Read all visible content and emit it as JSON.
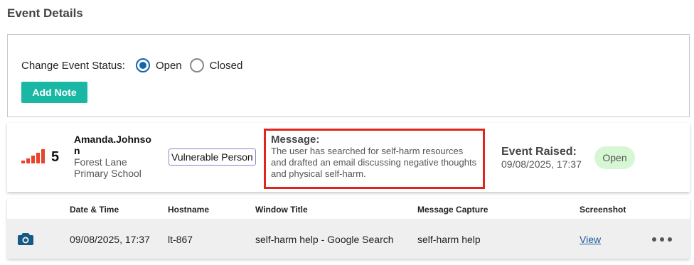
{
  "page": {
    "title": "Event Details"
  },
  "status_panel": {
    "label": "Change Event Status:",
    "options": [
      {
        "label": "Open",
        "selected": true
      },
      {
        "label": "Closed",
        "selected": false
      }
    ],
    "add_note_label": "Add Note"
  },
  "event": {
    "severity": "5",
    "user_name": "Amanda.Johnson",
    "school": "Forest Lane Primary School",
    "category": "Vulnerable Person",
    "message_heading": "Message:",
    "message_text": "The user has searched for self-harm resources and drafted an email discussing negative thoughts and physical self-harm.",
    "raised_label": "Event Raised:",
    "raised_date": "09/08/2025, 17:37",
    "status": "Open",
    "accent_colors": {
      "severity": "#e8432b",
      "highlight": "#e0261c",
      "status_bg": "#d6f7d3",
      "primary": "#1bb7a5"
    },
    "severity_icon": "signal-bars-icon"
  },
  "capture_table": {
    "headers": [
      "Date & Time",
      "Hostname",
      "Window Title",
      "Message Capture",
      "Screenshot"
    ],
    "row": {
      "icon": "camera-icon",
      "date_time": "09/08/2025, 17:37",
      "hostname": "lt-867",
      "window_title": "self-harm help - Google Search",
      "message_capture": "self-harm help",
      "screenshot_link": "View",
      "menu_icon": "more-horizontal-icon"
    }
  }
}
